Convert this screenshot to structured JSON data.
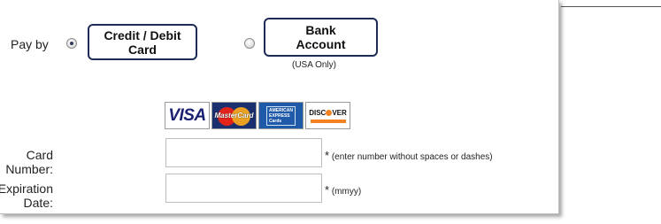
{
  "payment": {
    "pay_by_label": "Pay by",
    "selected": "card",
    "methods": {
      "card": {
        "label": "Credit / Debit\nCard"
      },
      "bank": {
        "label": "Bank\nAccount",
        "note": "(USA Only)"
      }
    }
  },
  "card_logos": {
    "visa": "VISA",
    "mastercard": "MasterCard",
    "amex_lines": [
      "AMERICAN",
      "EXPRESS",
      "Cards"
    ],
    "discover": "DISC VER"
  },
  "fields": {
    "card_number": {
      "label": "Card Number:",
      "value": "",
      "hint_star": "*",
      "hint": "(enter number without spaces or dashes)"
    },
    "expiration": {
      "label": "Expiration Date:",
      "value": "",
      "hint_star": "*",
      "hint": "(mmyy)"
    }
  },
  "colors": {
    "button_border": "#1d2b55",
    "radio_dot": "#2b3a55"
  }
}
